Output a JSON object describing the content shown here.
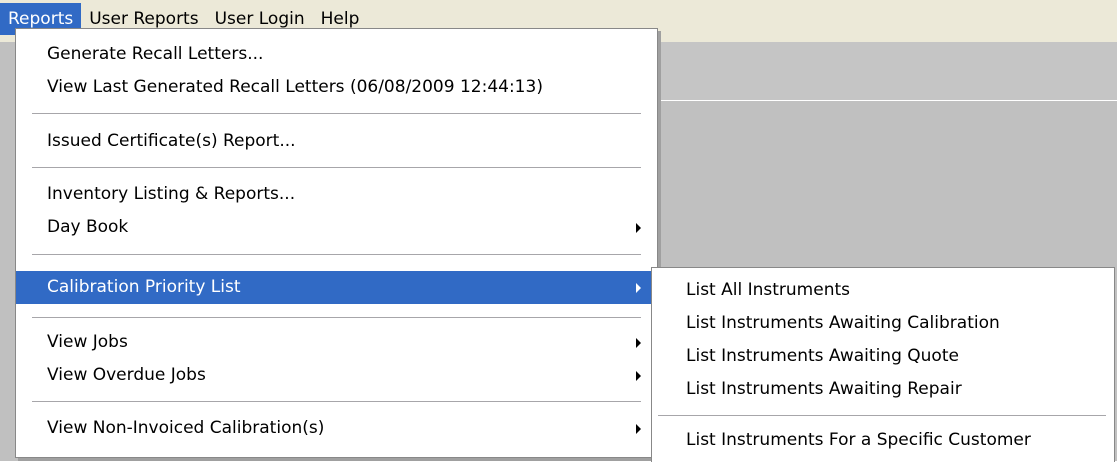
{
  "menubar": {
    "items": [
      {
        "label": "Reports",
        "active": true
      },
      {
        "label": "User Reports",
        "active": false
      },
      {
        "label": "User Login",
        "active": false
      },
      {
        "label": "Help",
        "active": false
      }
    ]
  },
  "reports_menu": {
    "items": [
      {
        "label": "Generate Recall Letters...",
        "submenu": false
      },
      {
        "label": "View Last Generated Recall Letters (06/08/2009 12:44:13)",
        "submenu": false
      },
      {
        "label": "Issued Certificate(s) Report...",
        "submenu": false
      },
      {
        "label": "Inventory Listing & Reports...",
        "submenu": false
      },
      {
        "label": "Day Book",
        "submenu": true
      },
      {
        "label": "Calibration Priority List",
        "submenu": true,
        "highlighted": true
      },
      {
        "label": "View Jobs",
        "submenu": true
      },
      {
        "label": "View Overdue Jobs",
        "submenu": true
      },
      {
        "label": "View Non-Invoiced Calibration(s)",
        "submenu": true
      }
    ]
  },
  "calibration_submenu": {
    "items": [
      {
        "label": "List All Instruments"
      },
      {
        "label": "List Instruments Awaiting Calibration"
      },
      {
        "label": "List Instruments Awaiting Quote"
      },
      {
        "label": "List Instruments Awaiting Repair"
      },
      {
        "label": "List Instruments For a Specific Customer"
      }
    ]
  },
  "colors": {
    "highlight": "#316ac5",
    "menubar_bg": "#ece9d8",
    "workspace_bg": "#c0c0c0"
  }
}
